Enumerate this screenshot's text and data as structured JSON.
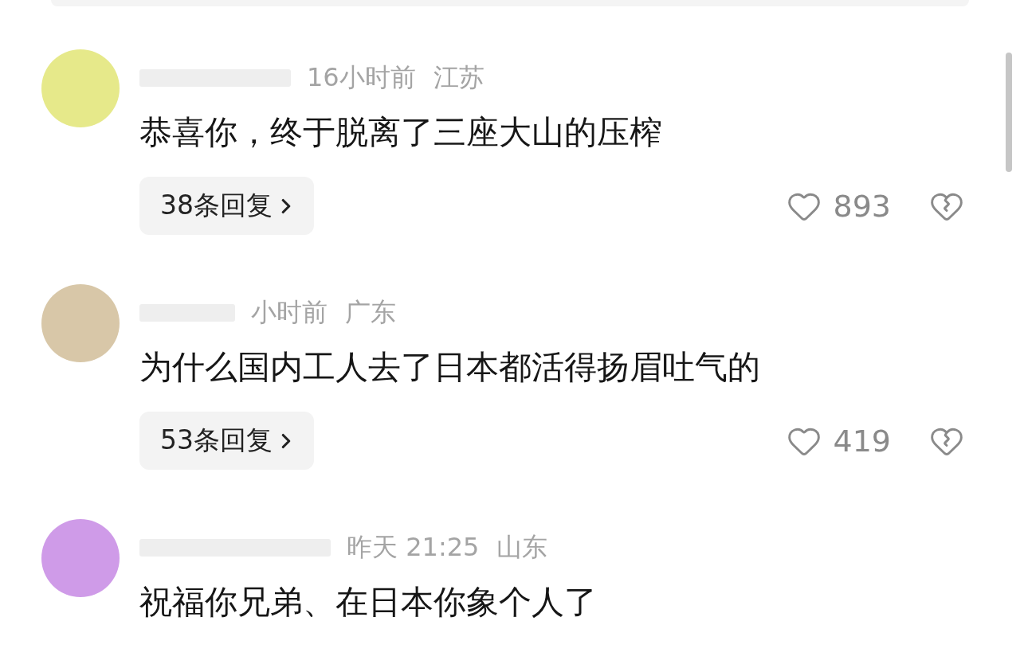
{
  "comments": [
    {
      "time": "16小时前",
      "location": "江苏",
      "text": "恭喜你，终于脱离了三座大山的压榨",
      "replies": "38条回复",
      "likes": "893"
    },
    {
      "time": "小时前",
      "location": "广东",
      "text": "为什么国内工人去了日本都活得扬眉吐气的",
      "replies": "53条回复",
      "likes": "419"
    },
    {
      "time": "昨天 21:25",
      "location": "山东",
      "text": "祝福你兄弟、在日本你象个人了"
    }
  ]
}
